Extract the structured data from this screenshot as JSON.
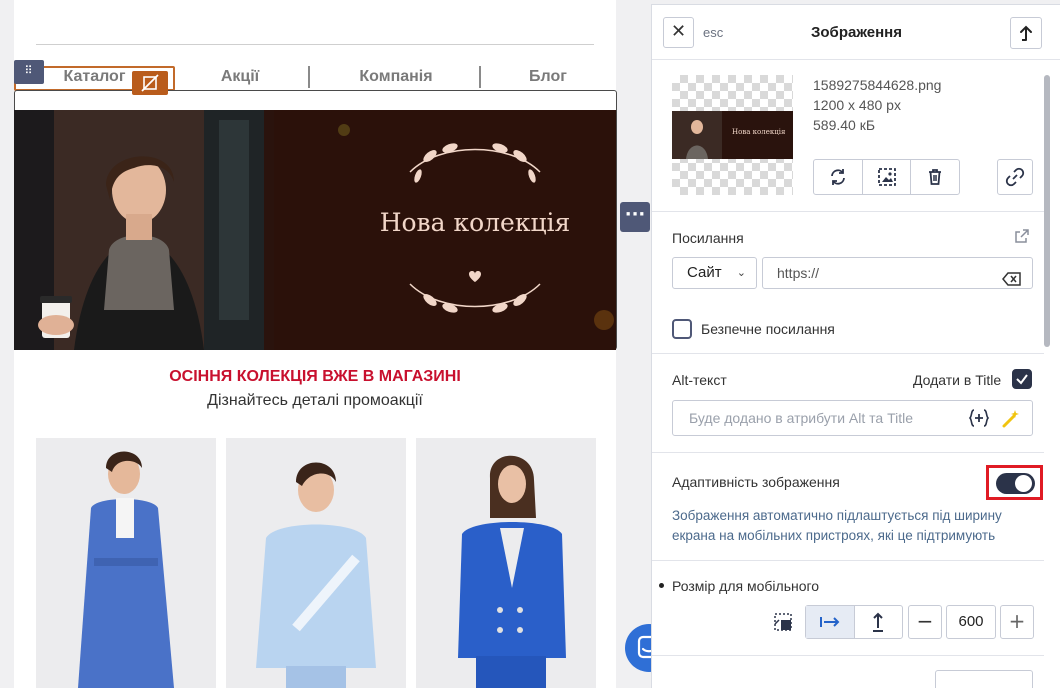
{
  "canvas": {
    "nav": {
      "items": [
        "Каталог",
        "Акції",
        "Компанія",
        "Блог"
      ]
    },
    "banner": {
      "text": "Нова колекція"
    },
    "promo": {
      "title": "ОСІННЯ КОЛЕКЦІЯ ВЖЕ В МАГАЗИНІ",
      "subtitle": "Дізнайтесь деталі промоакції"
    },
    "colors": {
      "promo_title": "#c8102e",
      "editor_accent": "#4f5877",
      "selection_outline": "#c26a2a"
    }
  },
  "panel": {
    "esc": "esc",
    "title": "Зображення",
    "file": {
      "name": "1589275844628.png",
      "dimensions": "1200 x 480 px",
      "size": "589.40 кБ",
      "thumb_text": "Нова колекція"
    },
    "link": {
      "label": "Посилання",
      "type": "Сайт",
      "url_placeholder": "https://",
      "safe_label": "Безпечне посилання",
      "safe_checked": false
    },
    "alt": {
      "label": "Alt-текст",
      "add_to_title_label": "Додати в Title",
      "add_to_title_checked": true,
      "placeholder": "Буде додано в атрибути Alt та Title"
    },
    "adaptive": {
      "label": "Адаптивність зображення",
      "enabled": true,
      "description": "Зображення автоматично підлаштується під ширину екрана на мобільних пристроях, які це підтримують"
    },
    "mobile_size": {
      "label": "Розмір для мобільного",
      "value": "600",
      "minus": "−",
      "plus": "+"
    }
  }
}
